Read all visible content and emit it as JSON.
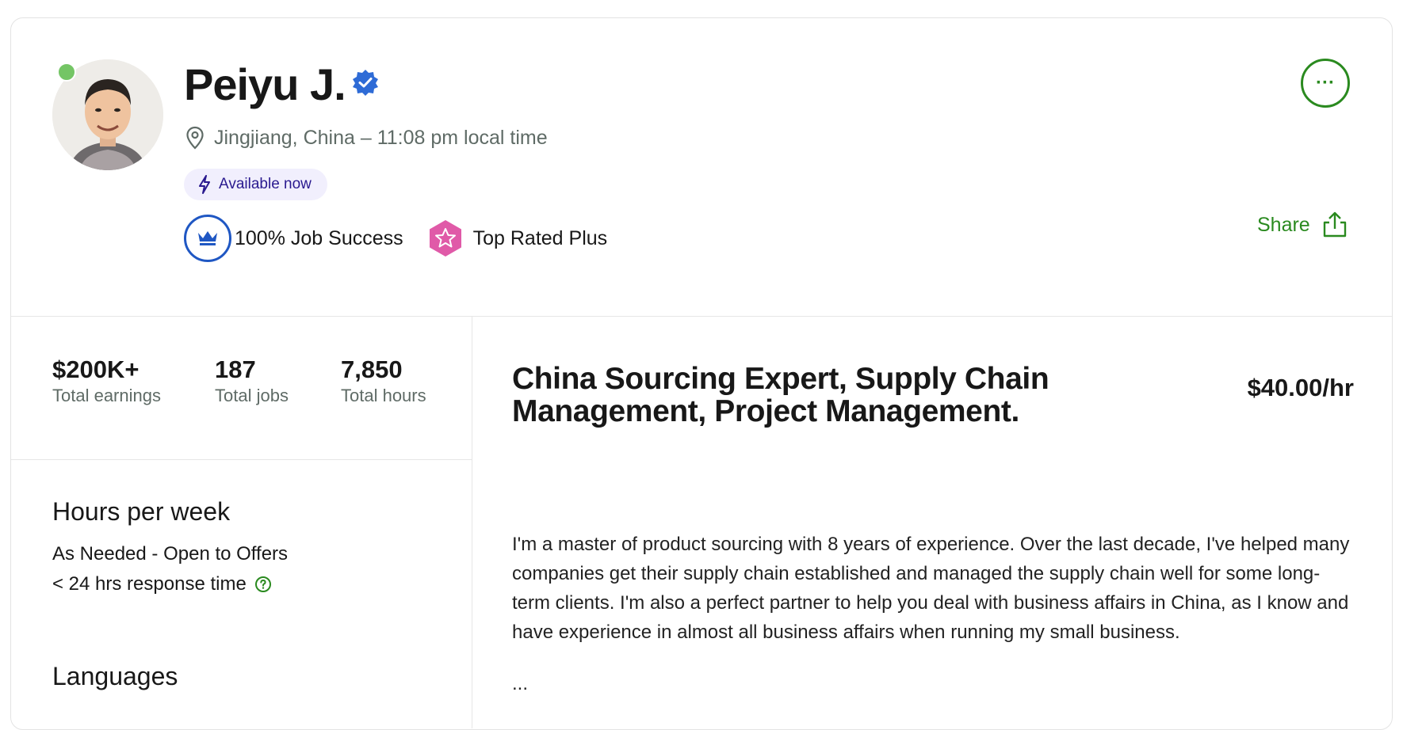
{
  "profile": {
    "name": "Peiyu J.",
    "location": "Jingjiang, China – 11:08 pm local time",
    "availability": "Available now",
    "job_success": "100% Job Success",
    "top_rated": "Top Rated Plus",
    "more_label": "···",
    "share_label": "Share"
  },
  "stats": [
    {
      "value": "$200K+",
      "label": "Total earnings"
    },
    {
      "value": "187",
      "label": "Total jobs"
    },
    {
      "value": "7,850",
      "label": "Total hours"
    }
  ],
  "sidebar": {
    "hours_title": "Hours per week",
    "hours_value": "As Needed - Open to Offers",
    "response_time": "< 24 hrs response time",
    "languages_title": "Languages"
  },
  "main": {
    "title": "China Sourcing Expert, Supply Chain Management, Project Management.",
    "rate": "$40.00/hr",
    "bio": "I'm a master of product sourcing with 8 years of experience. Over the last decade, I've helped many companies get their supply chain established and managed the supply chain well for some long-term clients. I'm also a perfect partner to help you deal with business affairs in China, as I know and have experience in almost all business affairs when running my small business.",
    "ellipsis": "..."
  },
  "colors": {
    "brand_green": "#2a8a1f",
    "online_green": "#74c565",
    "verified_blue": "#2e6bd6",
    "availability_bg": "#f1effd",
    "top_rated_pink": "#e05aa8"
  }
}
